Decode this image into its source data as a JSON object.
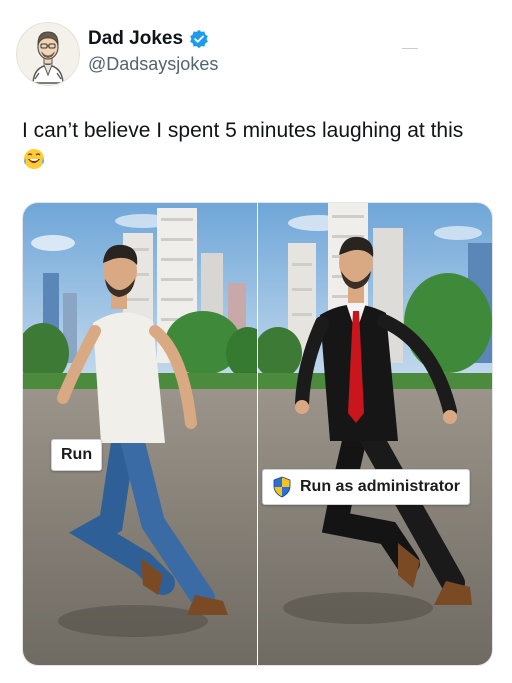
{
  "tweet": {
    "display_name": "Dad Jokes",
    "handle": "@Dadsaysjokes",
    "text": "I can’t believe I spent 5 minutes laughing at this",
    "emoji": "laughing-with-tears-icon"
  },
  "image": {
    "left_label": "Run",
    "right_label": "Run as administrator",
    "right_label_icon": "uac-shield-icon"
  },
  "colors": {
    "verified": "#1d9bf0",
    "handle": "#536471",
    "text": "#0f1419",
    "shield_blue": "#2a6fd6",
    "shield_yellow": "#f4c31d"
  }
}
